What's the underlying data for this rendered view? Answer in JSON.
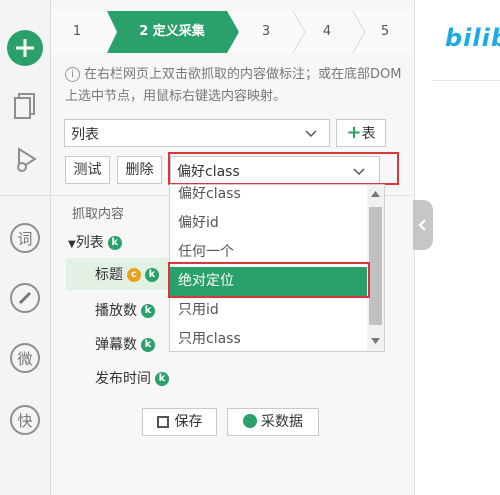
{
  "steps": {
    "s1": "1",
    "active": "2 定义采集",
    "s3": "3",
    "s4": "4",
    "s5": "5"
  },
  "hint": "在右栏网页上双击欲抓取的内容做标注；或在底部DOM上选中节点，用鼠标右键选内容映射。",
  "list_select": {
    "value": "列表",
    "add_label": "表"
  },
  "actions": {
    "test": "测试",
    "delete": "删除",
    "pref_select": "偏好class"
  },
  "section_label": "抓取内容",
  "tree": {
    "root": "列表",
    "root_badge": "k",
    "fields": [
      {
        "label": "标题",
        "badge": "k",
        "extra_badge": "c"
      },
      {
        "label": "播放数",
        "badge": "k"
      },
      {
        "label": "弹幕数",
        "badge": "k"
      },
      {
        "label": "发布时间",
        "badge": "k"
      }
    ]
  },
  "dropdown": {
    "options": [
      "偏好class",
      "偏好id",
      "任何一个",
      "绝对定位",
      "只用id",
      "只用class"
    ],
    "selected": "绝对定位"
  },
  "buttons": {
    "save": "保存",
    "collect": "采数据"
  },
  "site_logo_text": "bilibi",
  "colors": {
    "accent": "#2aa16a",
    "highlight": "#d9363e",
    "badge_orange": "#e8a21b"
  }
}
